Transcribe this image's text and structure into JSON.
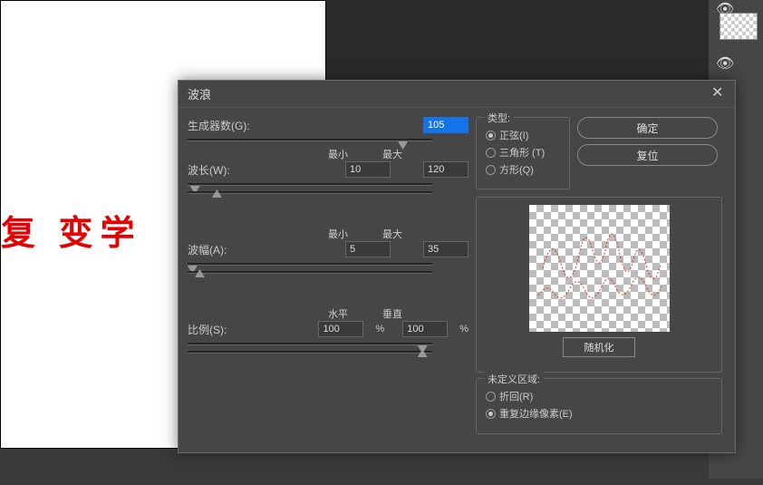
{
  "canvas": {
    "text": "复  变学"
  },
  "dialog": {
    "title": "波浪",
    "generators": {
      "label": "生成器数(G):",
      "value": "105"
    },
    "wavelength": {
      "label": "波长(W):",
      "min_label": "最小",
      "max_label": "最大",
      "min": "10",
      "max": "120"
    },
    "amplitude": {
      "label": "波幅(A):",
      "min_label": "最小",
      "max_label": "最大",
      "min": "5",
      "max": "35"
    },
    "scale": {
      "label": "比例(S):",
      "h_label": "水平",
      "v_label": "垂直",
      "h": "100",
      "v": "100",
      "pct": "%"
    },
    "type": {
      "title": "类型:",
      "options": [
        {
          "label": "正弦(I)",
          "checked": true
        },
        {
          "label": "三角形 (T)",
          "checked": false
        },
        {
          "label": "方形(Q)",
          "checked": false
        }
      ]
    },
    "buttons": {
      "ok": "确定",
      "reset": "复位",
      "randomize": "随机化"
    },
    "undefined_area": {
      "title": "未定义区域:",
      "options": [
        {
          "label": "折回(R)",
          "checked": false
        },
        {
          "label": "重复边缘像素(E)",
          "checked": true
        }
      ]
    }
  }
}
